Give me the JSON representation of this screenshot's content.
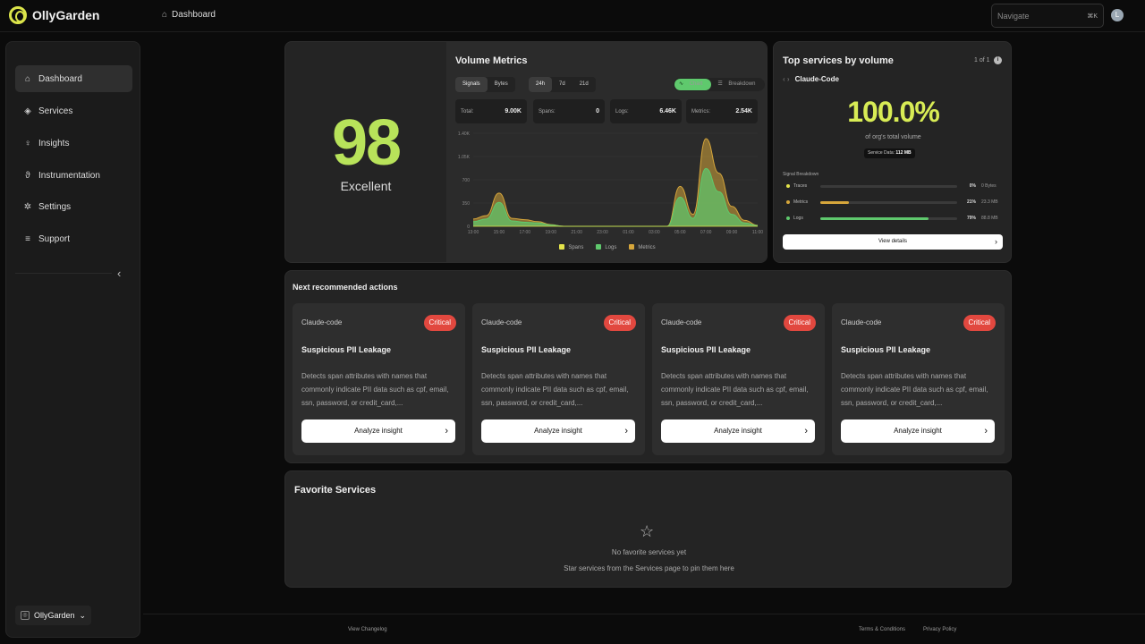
{
  "app": {
    "name": "OllyGarden"
  },
  "breadcrumb": {
    "label": "Dashboard"
  },
  "search": {
    "placeholder": "Navigate",
    "shortcut": "⌘K"
  },
  "user": {
    "initial": "L"
  },
  "sidebar": {
    "items": [
      {
        "label": "Dashboard",
        "icon": "home-icon"
      },
      {
        "label": "Services",
        "icon": "layers-icon"
      },
      {
        "label": "Insights",
        "icon": "lightbulb-icon"
      },
      {
        "label": "Instrumentation",
        "icon": "plug-icon"
      },
      {
        "label": "Settings",
        "icon": "gear-icon"
      },
      {
        "label": "Support",
        "icon": "support-icon"
      }
    ],
    "org": "OllyGarden"
  },
  "score": {
    "value": "98",
    "label": "Excellent",
    "color": "#b8e35a"
  },
  "volume": {
    "title": "Volume Metrics",
    "modes": [
      "Signals",
      "Bytes"
    ],
    "ranges": [
      "24h",
      "7d",
      "21d"
    ],
    "views": [
      "Chart",
      "Breakdown"
    ],
    "stats": [
      {
        "label": "Total:",
        "value": "9.00K"
      },
      {
        "label": "Spans:",
        "value": "0"
      },
      {
        "label": "Logs:",
        "value": "6.46K"
      },
      {
        "label": "Metrics:",
        "value": "2.54K"
      }
    ]
  },
  "chart_data": {
    "type": "area",
    "x": [
      "13:00",
      "14:00",
      "15:00",
      "16:00",
      "17:00",
      "18:00",
      "19:00",
      "20:00",
      "21:00",
      "22:00",
      "23:00",
      "00:00",
      "01:00",
      "02:00",
      "03:00",
      "04:00",
      "05:00",
      "06:00",
      "07:00",
      "08:00",
      "09:00",
      "10:00",
      "11:00"
    ],
    "xticks": [
      "13:00",
      "15:00",
      "17:00",
      "19:00",
      "21:00",
      "23:00",
      "01:00",
      "03:00",
      "05:00",
      "07:00",
      "09:00",
      "11:00"
    ],
    "yticks": [
      "0",
      "350",
      "700",
      "1.05K",
      "1.40K"
    ],
    "ylim": [
      0,
      1400
    ],
    "series": [
      {
        "name": "Spans",
        "color": "#e3e34a",
        "values": [
          0,
          0,
          0,
          0,
          0,
          0,
          0,
          0,
          0,
          0,
          0,
          0,
          0,
          0,
          0,
          0,
          0,
          0,
          0,
          0,
          0,
          0,
          0
        ]
      },
      {
        "name": "Logs",
        "color": "#5fc96d",
        "values": [
          70,
          110,
          360,
          80,
          60,
          50,
          20,
          0,
          0,
          0,
          0,
          0,
          0,
          0,
          0,
          0,
          440,
          120,
          870,
          520,
          180,
          50,
          10
        ]
      },
      {
        "name": "Metrics",
        "color": "#d6a63b",
        "values": [
          40,
          50,
          140,
          40,
          40,
          20,
          5,
          0,
          0,
          0,
          0,
          0,
          0,
          0,
          0,
          0,
          160,
          60,
          450,
          280,
          120,
          40,
          5
        ]
      }
    ],
    "grid": true,
    "legend": "bottom"
  },
  "top_services": {
    "title": "Top services by volume",
    "pager": "1 of 1",
    "service": "Claude-Code",
    "percent": "100.0%",
    "percent_label": "of org's total volume",
    "service_data_label": "Service Data:",
    "service_data_value": "112 MB",
    "breakdown_title": "Signal Breakdown",
    "breakdown": [
      {
        "name": "Traces",
        "pct": "0%",
        "size": "0 Bytes",
        "fill": 0,
        "color": "#e3e34a"
      },
      {
        "name": "Metrics",
        "pct": "21%",
        "size": "23.3 MB",
        "fill": 0.21,
        "color": "#d6a63b"
      },
      {
        "name": "Logs",
        "pct": "79%",
        "size": "88.8 MB",
        "fill": 0.79,
        "color": "#5fc96d"
      }
    ],
    "button": "View details"
  },
  "actions": {
    "title": "Next recommended actions",
    "cards": [
      {
        "service": "Claude-code",
        "severity": "Critical",
        "title": "Suspicious PII Leakage",
        "desc": "Detects span attributes with names that commonly indicate PII data such as cpf, email, ssn, password, or credit_card,...",
        "button": "Analyze insight"
      },
      {
        "service": "Claude-code",
        "severity": "Critical",
        "title": "Suspicious PII Leakage",
        "desc": "Detects span attributes with names that commonly indicate PII data such as cpf, email, ssn, password, or credit_card,...",
        "button": "Analyze insight"
      },
      {
        "service": "Claude-code",
        "severity": "Critical",
        "title": "Suspicious PII Leakage",
        "desc": "Detects span attributes with names that commonly indicate PII data such as cpf, email, ssn, password, or credit_card,...",
        "button": "Analyze insight"
      },
      {
        "service": "Claude-code",
        "severity": "Critical",
        "title": "Suspicious PII Leakage",
        "desc": "Detects span attributes with names that commonly indicate PII data such as cpf, email, ssn, password, or credit_card,...",
        "button": "Analyze insight"
      }
    ]
  },
  "favorites": {
    "title": "Favorite Services",
    "empty": "No favorite services yet",
    "hint": "Star services from the Services page to pin them here"
  },
  "footer": {
    "changelog": "View Changelog",
    "terms": "Terms & Conditions",
    "privacy": "Privacy Policy"
  }
}
